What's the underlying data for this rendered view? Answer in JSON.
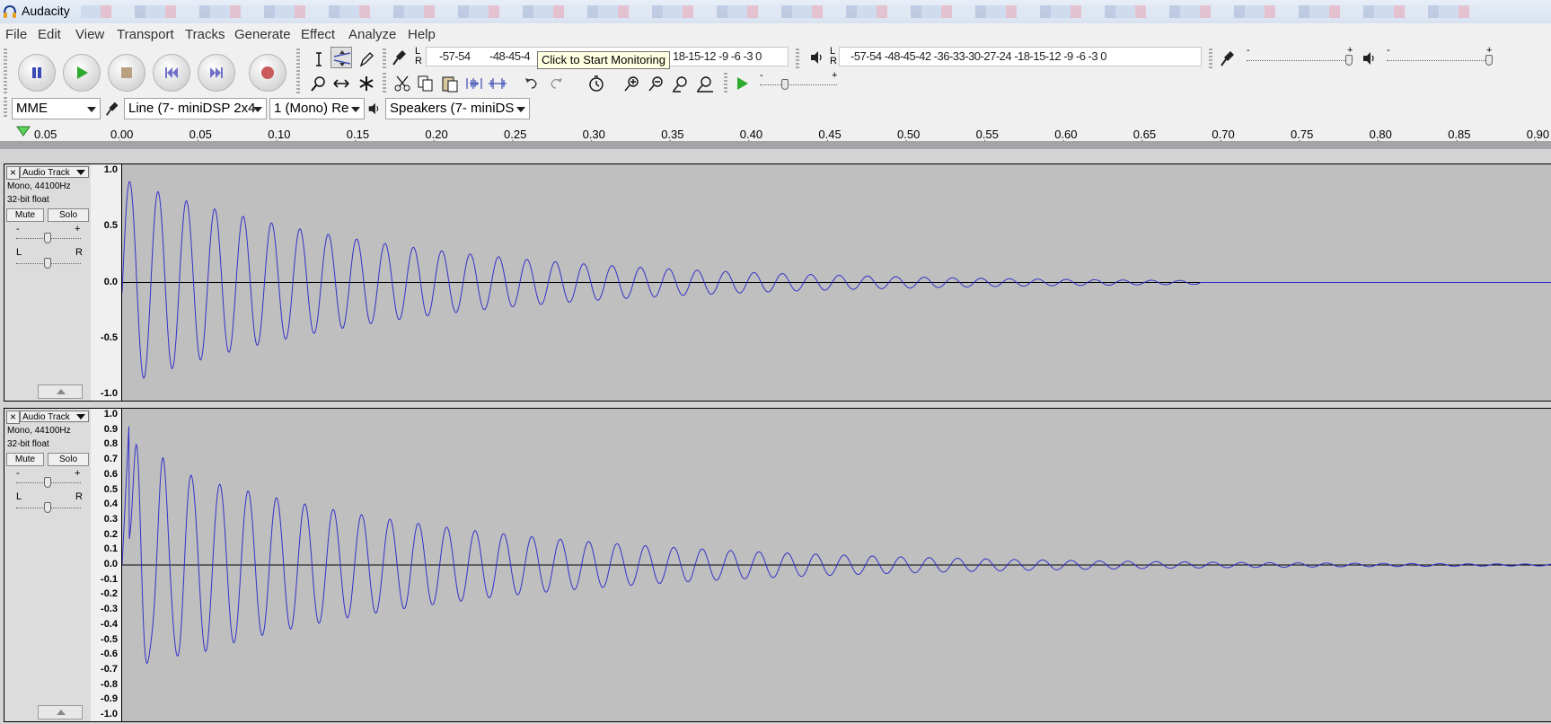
{
  "window": {
    "title": "Audacity"
  },
  "menu": [
    "File",
    "Edit",
    "View",
    "Transport",
    "Tracks",
    "Generate",
    "Effect",
    "Analyze",
    "Help"
  ],
  "transport": [
    {
      "name": "pause-button",
      "icon": "pause-icon"
    },
    {
      "name": "play-button",
      "icon": "play-icon"
    },
    {
      "name": "stop-button",
      "icon": "stop-icon"
    },
    {
      "name": "skip-to-start-button",
      "icon": "skip-start-icon"
    },
    {
      "name": "skip-to-end-button",
      "icon": "skip-end-icon"
    },
    {
      "name": "record-button",
      "icon": "record-icon"
    }
  ],
  "meters": {
    "record_scale_left": "-57-54",
    "record_scale_mid": "-48-45-4",
    "record_scale_right": "18-15-12 -9 -6 -3 0",
    "tooltip": "Click to Start Monitoring",
    "playback_scale": "-57-54      -48-45-42      -36-33-30-27-24      -18-15-12 -9 -6 -3 0",
    "l": "L",
    "r": "R"
  },
  "mixer": {
    "minus": "-",
    "plus": "+"
  },
  "device": {
    "host": "MME",
    "input": "Line (7- miniDSP 2x4",
    "channels": "1 (Mono) Re",
    "output": "Speakers (7- miniDS"
  },
  "ruler": {
    "left_label": "0.05",
    "labels": [
      "0.00",
      "0.05",
      "0.10",
      "0.15",
      "0.20",
      "0.25",
      "0.30",
      "0.35",
      "0.40",
      "0.45",
      "0.50",
      "0.55",
      "0.60",
      "0.65",
      "0.70",
      "0.75",
      "0.80",
      "0.85",
      "0.90"
    ]
  },
  "tracks": [
    {
      "name": "Audio Track",
      "info1": "Mono, 44100Hz",
      "info2": "32-bit float",
      "mute": "Mute",
      "solo": "Solo",
      "gain_minus": "-",
      "gain_plus": "+",
      "pan_l": "L",
      "pan_r": "R",
      "scale": [
        "1.0",
        "0.5",
        "0.0",
        "-0.5",
        "-1.0"
      ]
    },
    {
      "name": "Audio Track",
      "info1": "Mono, 44100Hz",
      "info2": "32-bit float",
      "mute": "Mute",
      "solo": "Solo",
      "gain_minus": "-",
      "gain_plus": "+",
      "pan_l": "L",
      "pan_r": "R",
      "scale": [
        "1.0",
        "0.9",
        "0.8",
        "0.7",
        "0.6",
        "0.5",
        "0.4",
        "0.3",
        "0.2",
        "0.1",
        "0.0",
        "-0.1",
        "-0.2",
        "-0.3",
        "-0.4",
        "-0.5",
        "-0.6",
        "-0.7",
        "-0.8",
        "-0.9",
        "-1.0"
      ]
    }
  ],
  "colors": {
    "waveform": "#3232c8",
    "wave_bg": "#bfbfbf",
    "record": "#c83232",
    "play": "#2eaa2e"
  }
}
